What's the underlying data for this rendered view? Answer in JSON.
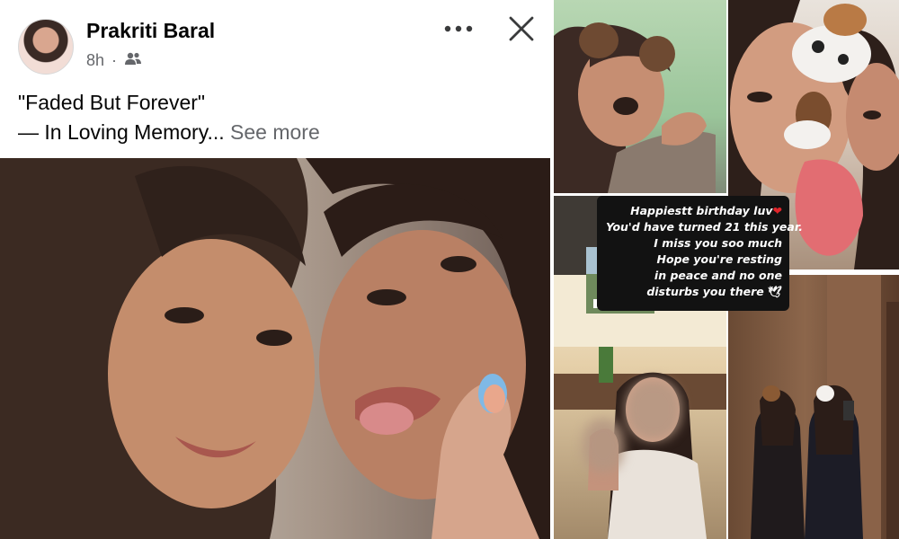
{
  "post": {
    "author": "Prakriti Baral",
    "time": "8h",
    "separator": "·",
    "audience_icon": "friends-icon",
    "more_icon": "more-icon",
    "close_icon": "close-icon",
    "caption_line1": "\"Faded But Forever\"",
    "caption_line2": "— In Loving Memory...",
    "see_more": "See more"
  },
  "story": {
    "line1": "Happiestt birthday luv",
    "line1_icon": "heart-icon",
    "line2": "You'd  have turned 21 this year.",
    "line3": "I miss you soo much",
    "line4": "Hope you're resting",
    "line5": "in peace and no one",
    "line6": "disturbs you there",
    "line6_icon": "dove-icon"
  },
  "colors": {
    "name": "#050505",
    "meta": "#65676b",
    "heart": "#e0242a",
    "story_bg": "#121212"
  }
}
